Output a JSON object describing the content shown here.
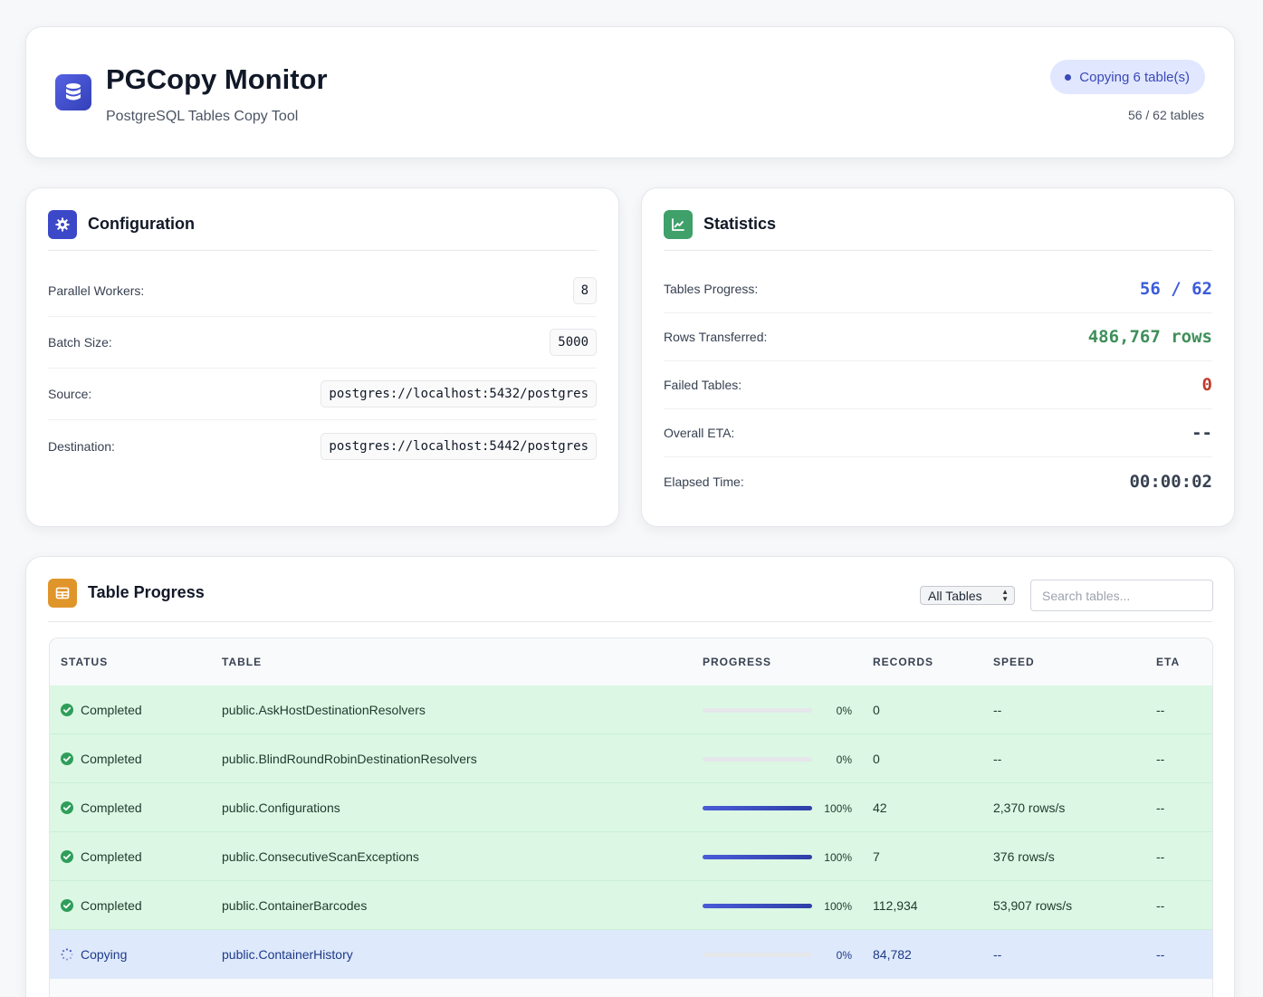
{
  "header": {
    "title": "PGCopy Monitor",
    "subtitle": "PostgreSQL Tables Copy Tool",
    "status": "Copying 6 table(s)",
    "table_count": "56 / 62 tables",
    "logo_icon": "database-icon",
    "accent": "#3b48b8"
  },
  "config": {
    "title": "Configuration",
    "icon": "gear-icon",
    "rows": [
      {
        "label": "Parallel Workers:",
        "value": "8"
      },
      {
        "label": "Batch Size:",
        "value": "5000"
      },
      {
        "label": "Source:",
        "value": "postgres://localhost:5432/postgres"
      },
      {
        "label": "Destination:",
        "value": "postgres://localhost:5442/postgres"
      }
    ]
  },
  "stats": {
    "title": "Statistics",
    "icon": "chart-line-icon",
    "rows": [
      {
        "label": "Tables Progress:",
        "value": "56 / 62",
        "color": "#3b5bdb"
      },
      {
        "label": "Rows Transferred:",
        "value": "486,767 rows",
        "color": "#3f8f5a"
      },
      {
        "label": "Failed Tables:",
        "value": "0",
        "color": "#c0392b"
      },
      {
        "label": "Overall ETA:",
        "value": "--",
        "color": "#374151"
      },
      {
        "label": "Elapsed Time:",
        "value": "00:00:02",
        "color": "#374151"
      }
    ]
  },
  "progress": {
    "title": "Table Progress",
    "icon": "table-icon",
    "filter": "All Tables",
    "search_placeholder": "Search tables...",
    "columns": [
      "STATUS",
      "TABLE",
      "PROGRESS",
      "RECORDS",
      "SPEED",
      "ETA"
    ],
    "rows": [
      {
        "status": "Completed",
        "table": "public.AskHostDestinationResolvers",
        "progress": 0,
        "pct": "0%",
        "records": "0",
        "speed": "--",
        "eta": "--"
      },
      {
        "status": "Completed",
        "table": "public.BlindRoundRobinDestinationResolvers",
        "progress": 0,
        "pct": "0%",
        "records": "0",
        "speed": "--",
        "eta": "--"
      },
      {
        "status": "Completed",
        "table": "public.Configurations",
        "progress": 100,
        "pct": "100%",
        "records": "42",
        "speed": "2,370 rows/s",
        "eta": "--"
      },
      {
        "status": "Completed",
        "table": "public.ConsecutiveScanExceptions",
        "progress": 100,
        "pct": "100%",
        "records": "7",
        "speed": "376 rows/s",
        "eta": "--"
      },
      {
        "status": "Completed",
        "table": "public.ContainerBarcodes",
        "progress": 100,
        "pct": "100%",
        "records": "112,934",
        "speed": "53,907 rows/s",
        "eta": "--"
      },
      {
        "status": "Copying",
        "table": "public.ContainerHistory",
        "progress": 0,
        "pct": "0%",
        "records": "84,782",
        "speed": "--",
        "eta": "--"
      }
    ]
  }
}
